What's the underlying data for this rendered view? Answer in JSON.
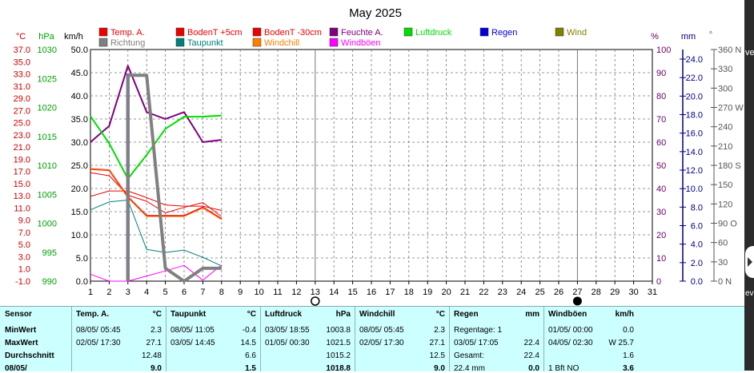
{
  "chart_data": {
    "type": "line",
    "title": "May 2025",
    "x": [
      1,
      2,
      3,
      4,
      5,
      6,
      7,
      8,
      9,
      10,
      11,
      12,
      13,
      14,
      15,
      16,
      17,
      18,
      19,
      20,
      21,
      22,
      23,
      24,
      25,
      26,
      27,
      28,
      29,
      30,
      31
    ],
    "xlim": [
      1,
      31
    ],
    "grid": true,
    "legend_position": "top",
    "axes": {
      "temp": {
        "label": "°C",
        "ticks": [
          "37.0",
          "35.0",
          "33.0",
          "31.0",
          "29.0",
          "27.0",
          "25.0",
          "23.0",
          "21.0",
          "19.0",
          "17.0",
          "15.0",
          "13.0",
          "11.0",
          "9.0",
          "7.0",
          "5.0",
          "3.0",
          "1.0",
          "-1.0"
        ],
        "range": [
          -1,
          37
        ],
        "color": "#cc0000"
      },
      "pressure": {
        "label": "hPa",
        "ticks": [
          "1030",
          "1025",
          "1020",
          "1015",
          "1010",
          "1005",
          "1000",
          "995",
          "990"
        ],
        "range": [
          990,
          1030
        ],
        "color": "#00a000"
      },
      "wind": {
        "label": "km/h",
        "ticks": [
          "50.0",
          "45.0",
          "40.0",
          "35.0",
          "30.0",
          "25.0",
          "20.0",
          "15.0",
          "10.0",
          "5.0",
          "0.0"
        ],
        "range": [
          0,
          50
        ],
        "color": "#000000"
      },
      "humidity": {
        "label": "%",
        "ticks": [
          "100",
          "90",
          "80",
          "70",
          "60",
          "50",
          "40",
          "30",
          "20",
          "10",
          "0"
        ],
        "range": [
          0,
          100
        ],
        "color": "#660066"
      },
      "rain": {
        "label": "mm",
        "ticks": [
          "24.0",
          "22.0",
          "20.0",
          "18.0",
          "16.0",
          "14.0",
          "12.0",
          "10.0",
          "8.0",
          "6.0",
          "4.0",
          "2.0",
          "0.0"
        ],
        "range": [
          0,
          25
        ],
        "color": "#000080"
      },
      "direction": {
        "label": "°",
        "ticks": [
          "360 N",
          "330",
          "300",
          "270 W",
          "240",
          "210",
          "180 S",
          "150",
          "120",
          "90 O",
          "60",
          "30",
          "0 N"
        ],
        "range": [
          0,
          360
        ],
        "color": "#555555"
      }
    },
    "legend": [
      {
        "name": "Temp. A.",
        "color": "#ee0000"
      },
      {
        "name": "BodenT +5cm",
        "color": "#ee0000"
      },
      {
        "name": "BodenT -30cm",
        "color": "#ee0000"
      },
      {
        "name": "Feuchte A.",
        "color": "#800080"
      },
      {
        "name": "Luftdruck",
        "color": "#00dd00"
      },
      {
        "name": "Regen",
        "color": "#0000dd"
      },
      {
        "name": "Wind",
        "color": "#808000"
      },
      {
        "name": "Richtung",
        "color": "#808080"
      },
      {
        "name": "Taupunkt",
        "color": "#008080"
      },
      {
        "name": "Windchill",
        "color": "#ff8000"
      },
      {
        "name": "Windböen",
        "color": "#ff00ff"
      }
    ],
    "moon_phases": [
      {
        "day": 13,
        "phase": "full"
      },
      {
        "day": 27,
        "phase": "new"
      }
    ],
    "series": [
      {
        "name": "Temp. A.",
        "axis": "temp",
        "color": "#ee0000",
        "width": 2,
        "points": [
          [
            1,
            17.4
          ],
          [
            2,
            17.2
          ],
          [
            3,
            12.8
          ],
          [
            4,
            9.7
          ],
          [
            5,
            9.7
          ],
          [
            6,
            9.7
          ],
          [
            7,
            11.1
          ],
          [
            8,
            9.2
          ]
        ]
      },
      {
        "name": "BodenT +5cm",
        "axis": "temp",
        "color": "#ee0000",
        "width": 1,
        "points": [
          [
            1,
            12.9
          ],
          [
            2,
            13.8
          ],
          [
            3,
            13.8
          ],
          [
            4,
            12.7
          ],
          [
            5,
            11.5
          ],
          [
            6,
            11.3
          ],
          [
            7,
            11.3
          ],
          [
            8,
            10.6
          ]
        ]
      },
      {
        "name": "BodenT -30cm",
        "axis": "temp",
        "color": "#ee0000",
        "width": 1,
        "points": [
          [
            1,
            16.8
          ],
          [
            2,
            16.3
          ],
          [
            3,
            13.1
          ],
          [
            4,
            12.1
          ],
          [
            5,
            10.2
          ],
          [
            6,
            11.1
          ],
          [
            7,
            11.9
          ],
          [
            8,
            9.6
          ]
        ]
      },
      {
        "name": "Taupunkt",
        "axis": "temp",
        "color": "#008080",
        "width": 1,
        "points": [
          [
            1,
            10.7
          ],
          [
            2,
            12.0
          ],
          [
            3,
            12.3
          ],
          [
            4,
            4.2
          ],
          [
            5,
            3.7
          ],
          [
            6,
            4.1
          ],
          [
            7,
            2.9
          ],
          [
            8,
            1.5
          ]
        ]
      },
      {
        "name": "Windchill",
        "axis": "temp",
        "color": "#ff8000",
        "width": 1,
        "points": [
          [
            1,
            17.4
          ],
          [
            2,
            17.2
          ],
          [
            3,
            12.7
          ],
          [
            4,
            9.6
          ],
          [
            5,
            9.6
          ],
          [
            6,
            9.6
          ],
          [
            7,
            11.0
          ],
          [
            8,
            9.1
          ]
        ]
      },
      {
        "name": "Windböen",
        "axis": "wind",
        "color": "#ff00ff",
        "width": 1,
        "points": [
          [
            1,
            1.5
          ],
          [
            2,
            0.0
          ],
          [
            3,
            0.0
          ],
          [
            4,
            1.1
          ],
          [
            5,
            2.2
          ],
          [
            6,
            3.4
          ],
          [
            7,
            0.2
          ],
          [
            8,
            3.5
          ]
        ]
      },
      {
        "name": "Feuchte A.",
        "axis": "humidity",
        "color": "#800080",
        "width": 2,
        "points": [
          [
            1,
            60
          ],
          [
            2,
            67
          ],
          [
            3,
            93
          ],
          [
            4,
            73
          ],
          [
            5,
            70
          ],
          [
            6,
            73
          ],
          [
            7,
            60
          ],
          [
            8,
            61
          ]
        ]
      },
      {
        "name": "Luftdruck",
        "axis": "pressure",
        "color": "#00dd00",
        "width": 2,
        "points": [
          [
            1,
            1018.5
          ],
          [
            2,
            1013.8
          ],
          [
            3,
            1007.7
          ],
          [
            4,
            1011.8
          ],
          [
            5,
            1016.3
          ],
          [
            6,
            1018.4
          ],
          [
            7,
            1018.4
          ],
          [
            8,
            1018.6
          ]
        ]
      },
      {
        "name": "Richtung",
        "axis": "direction",
        "color": "#808080",
        "width": 4,
        "points": [
          [
            3,
            0
          ],
          [
            3,
            320
          ],
          [
            4,
            320
          ],
          [
            5,
            20
          ],
          [
            6,
            0
          ],
          [
            7,
            20
          ],
          [
            8,
            20
          ]
        ]
      }
    ],
    "bars": [
      {
        "name": "Regen",
        "axis": "rain",
        "color": "#0000dd",
        "x": 3,
        "value": 22.4
      }
    ]
  },
  "stats": {
    "columns": [
      {
        "header": "Sensor",
        "unit": "",
        "rows": [
          [
            "MinWert",
            ""
          ],
          [
            "MaxWert",
            ""
          ],
          [
            "Durchschnitt",
            ""
          ],
          [
            "08/05/",
            ""
          ]
        ]
      },
      {
        "header": "Temp. A.",
        "unit": "°C",
        "rows": [
          [
            "08/05/ 05:45",
            "2.3"
          ],
          [
            "02/05/ 17:30",
            "27.1"
          ],
          [
            "",
            "12.48"
          ],
          [
            "",
            "9.0"
          ]
        ]
      },
      {
        "header": "Taupunkt",
        "unit": "°C",
        "rows": [
          [
            "08/05/ 11:05",
            "-0.4"
          ],
          [
            "03/05/ 14:45",
            "14.5"
          ],
          [
            "",
            "6.6"
          ],
          [
            "",
            "1.5"
          ]
        ]
      },
      {
        "header": "Luftdruck",
        "unit": "hPa",
        "rows": [
          [
            "03/05/ 18:55",
            "1003.8"
          ],
          [
            "01/05/ 00:30",
            "1021.5"
          ],
          [
            "",
            "1015.2"
          ],
          [
            "",
            "1018.8"
          ]
        ]
      },
      {
        "header": "Windchill",
        "unit": "°C",
        "rows": [
          [
            "08/05/ 05:45",
            "2.3"
          ],
          [
            "02/05/ 17:30",
            "27.1"
          ],
          [
            "",
            "12.5"
          ],
          [
            "",
            "9.0"
          ]
        ]
      },
      {
        "header": "Regen",
        "unit": "mm",
        "rows": [
          [
            "Regentage: 1",
            ""
          ],
          [
            "03/05/ 17:05",
            "22.4"
          ],
          [
            "Gesamt:",
            "22.4"
          ],
          [
            "22.4 mm",
            "0.0"
          ]
        ]
      },
      {
        "header": "Windböen",
        "unit": "km/h",
        "rows": [
          [
            "01/05/ 00:00",
            "0.0"
          ],
          [
            "04/05/ 02:30",
            "W 25.7"
          ],
          [
            "",
            "1.6"
          ],
          [
            "1 Bft NO",
            "3.6"
          ]
        ]
      }
    ]
  },
  "edge": {
    "top_text": "ve",
    "bottom_text": "ev"
  }
}
